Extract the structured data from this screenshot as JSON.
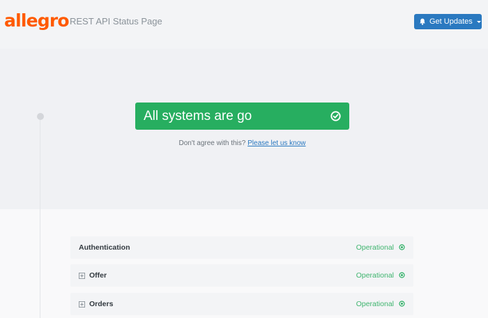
{
  "header": {
    "logo": "allegro",
    "title": "REST API Status Page",
    "updates_label": "Get Updates"
  },
  "status": {
    "message": "All systems are go",
    "disagree_text": "Don't agree with this?",
    "disagree_link": "Please let us know"
  },
  "components": [
    {
      "name": "Authentication",
      "status": "Operational",
      "expandable": false
    },
    {
      "name": "Offer",
      "status": "Operational",
      "expandable": true
    },
    {
      "name": "Orders",
      "status": "Operational",
      "expandable": true
    }
  ],
  "colors": {
    "brand": "#ff5a00",
    "accent": "#2a79c0",
    "operational": "#27ae60"
  }
}
